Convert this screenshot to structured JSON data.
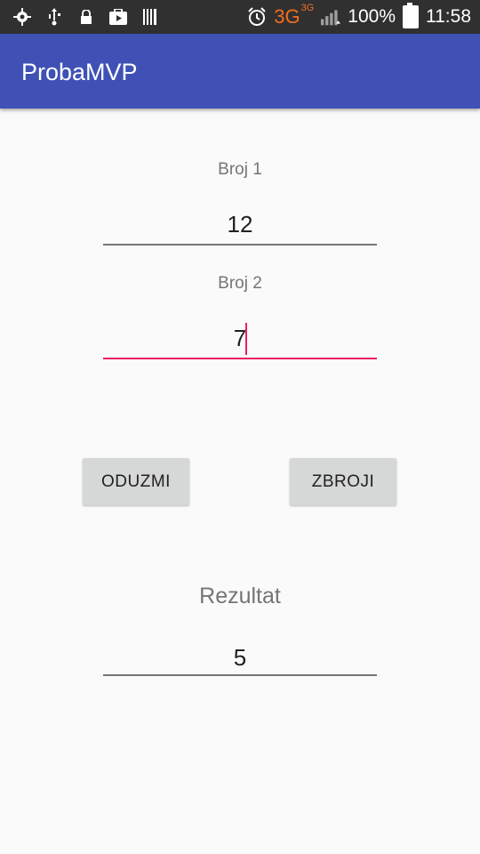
{
  "status_bar": {
    "network": "3G",
    "network_sup": "3G",
    "battery": "100%",
    "time": "11:58",
    "icons_left": [
      "settings-icon",
      "usb-icon",
      "lock-icon",
      "play-store-icon",
      "barcode-icon"
    ],
    "icons_right": [
      "alarm-icon",
      "signal-icon",
      "battery-icon"
    ]
  },
  "app_bar": {
    "title": "ProbaMVP"
  },
  "form": {
    "field1": {
      "label": "Broj 1",
      "value": "12"
    },
    "field2": {
      "label": "Broj 2",
      "value": "7"
    }
  },
  "buttons": {
    "subtract": "ODUZMI",
    "add": "ZBROJI"
  },
  "result": {
    "label": "Rezultat",
    "value": "5"
  },
  "colors": {
    "primary": "#3F51B5",
    "accent": "#E91E63",
    "network": "#F26D21"
  }
}
